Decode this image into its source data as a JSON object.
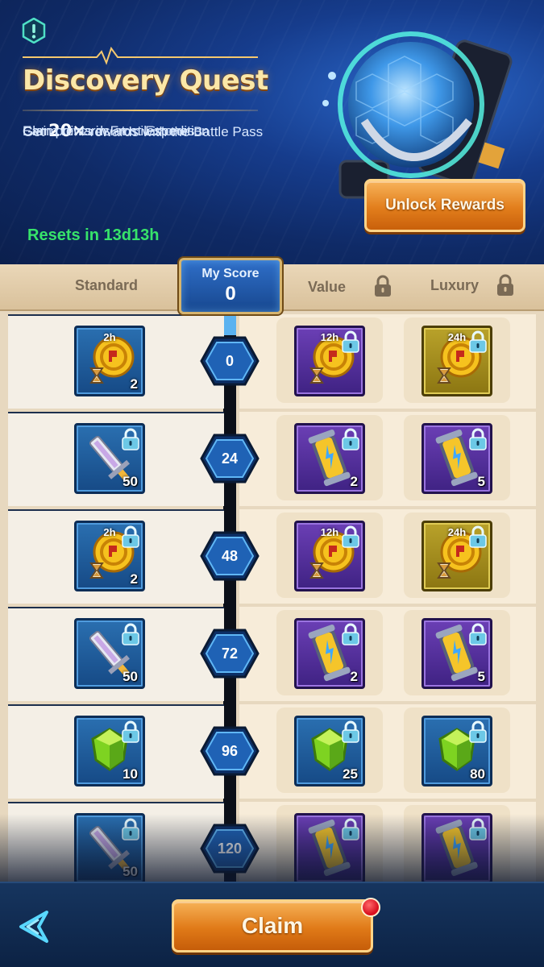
{
  "header": {
    "title": "Discovery Quest",
    "desc_line1_prefix": "Get ",
    "desc_line1_multiplier": "20×",
    "desc_line1_suffix": " rewards with the Battle Pass",
    "desc_line2": "Earn points in Frost Expedition",
    "desc_line3": "Claim rewards at milestones",
    "resets": "Resets in 13d13h",
    "unlock_button": "Unlock Rewards"
  },
  "tabs": {
    "standard": "Standard",
    "value": "Value",
    "luxury": "Luxury",
    "value_locked": true,
    "luxury_locked": true
  },
  "score": {
    "label": "My Score",
    "value": "0"
  },
  "milestones": [
    {
      "points": "0",
      "standard": {
        "item": "speedup-icon",
        "frame": "blue",
        "duration": "2h",
        "qty": "2",
        "locked": false
      },
      "value": {
        "item": "speedup-icon",
        "frame": "purple",
        "duration": "12h",
        "qty": "",
        "locked": true
      },
      "luxury": {
        "item": "speedup-icon",
        "frame": "gold",
        "duration": "24h",
        "qty": "",
        "locked": true
      }
    },
    {
      "points": "24",
      "standard": {
        "item": "blade-icon",
        "frame": "blue",
        "duration": "",
        "qty": "50",
        "locked": true
      },
      "value": {
        "item": "energy-cell-icon",
        "frame": "purple",
        "duration": "",
        "qty": "2",
        "locked": true
      },
      "luxury": {
        "item": "energy-cell-icon",
        "frame": "purple",
        "duration": "",
        "qty": "5",
        "locked": true
      }
    },
    {
      "points": "48",
      "standard": {
        "item": "speedup-icon",
        "frame": "blue",
        "duration": "2h",
        "qty": "2",
        "locked": true
      },
      "value": {
        "item": "speedup-icon",
        "frame": "purple",
        "duration": "12h",
        "qty": "",
        "locked": true
      },
      "luxury": {
        "item": "speedup-icon",
        "frame": "gold",
        "duration": "24h",
        "qty": "",
        "locked": true
      }
    },
    {
      "points": "72",
      "standard": {
        "item": "blade-icon",
        "frame": "blue",
        "duration": "",
        "qty": "50",
        "locked": true
      },
      "value": {
        "item": "energy-cell-icon",
        "frame": "purple",
        "duration": "",
        "qty": "2",
        "locked": true
      },
      "luxury": {
        "item": "energy-cell-icon",
        "frame": "purple",
        "duration": "",
        "qty": "5",
        "locked": true
      }
    },
    {
      "points": "96",
      "standard": {
        "item": "green-gem-icon",
        "frame": "blue",
        "duration": "",
        "qty": "10",
        "locked": true
      },
      "value": {
        "item": "green-gem-icon",
        "frame": "blue",
        "duration": "",
        "qty": "25",
        "locked": true
      },
      "luxury": {
        "item": "green-gem-icon",
        "frame": "blue",
        "duration": "",
        "qty": "80",
        "locked": true
      }
    },
    {
      "points": "120",
      "standard": {
        "item": "blade-icon",
        "frame": "blue",
        "duration": "",
        "qty": "50",
        "locked": true
      },
      "value": {
        "item": "energy-cell-icon",
        "frame": "purple",
        "duration": "",
        "qty": "",
        "locked": true
      },
      "luxury": {
        "item": "energy-cell-icon",
        "frame": "purple",
        "duration": "",
        "qty": "",
        "locked": true
      }
    }
  ],
  "footer": {
    "claim_button": "Claim",
    "claim_has_notification": true
  },
  "colors": {
    "accent_orange": "#e27e1c",
    "resets_green": "#37e36a",
    "frame_blue": "#1e5c9c",
    "frame_purple": "#5a2fa3",
    "frame_gold": "#a68e1e"
  }
}
